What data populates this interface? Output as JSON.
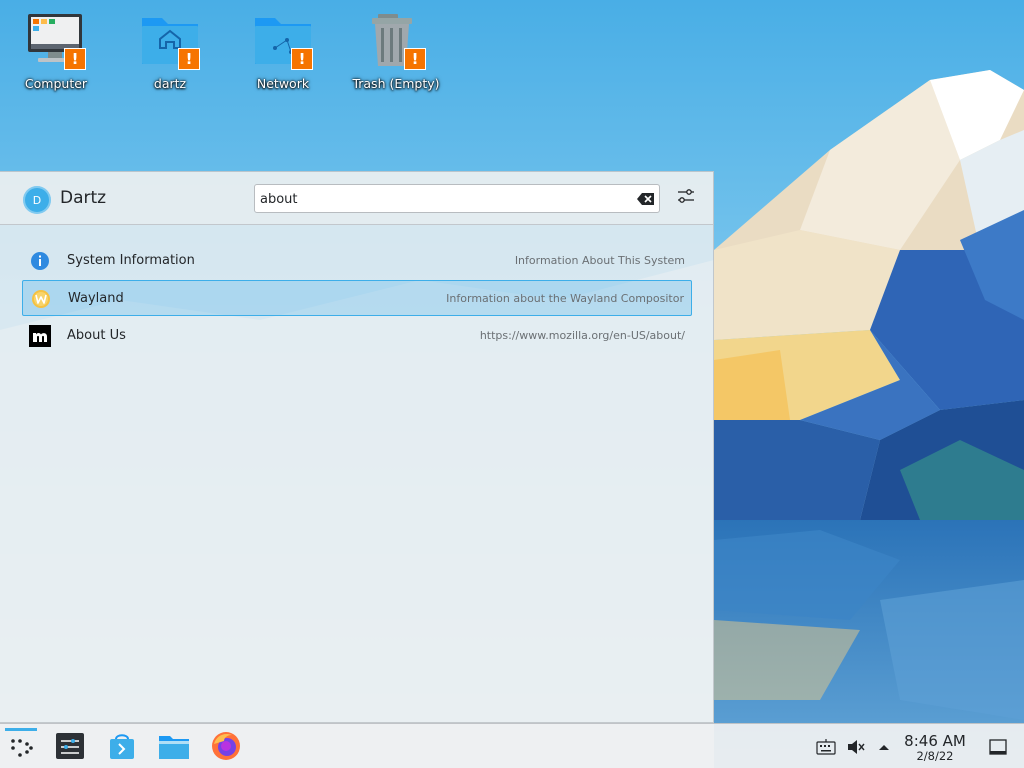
{
  "desktop": {
    "icons": [
      {
        "label": "Computer",
        "icon": "computer-icon"
      },
      {
        "label": "dartz",
        "icon": "home-folder-icon"
      },
      {
        "label": "Network",
        "icon": "network-folder-icon"
      },
      {
        "label": "Trash (Empty)",
        "icon": "trash-icon"
      }
    ],
    "warning_symbol": "!"
  },
  "launcher": {
    "user": {
      "initial": "D",
      "name": "Dartz"
    },
    "search": {
      "value": "about"
    },
    "results": [
      {
        "title": "System Information",
        "subtitle": "Information About This System",
        "icon": "info-icon",
        "selected": false
      },
      {
        "title": "Wayland",
        "subtitle": "Information about the Wayland Compositor",
        "icon": "wayland-icon",
        "selected": true
      },
      {
        "title": "About Us",
        "subtitle": "https://www.mozilla.org/en-US/about/",
        "icon": "mozilla-icon",
        "selected": false
      }
    ]
  },
  "taskbar": {
    "apps": [
      "application-launcher-icon",
      "system-settings-icon",
      "discover-icon",
      "dolphin-icon",
      "firefox-icon"
    ],
    "tray": [
      "keyboard-icon",
      "volume-muted-icon",
      "tray-expand-icon"
    ],
    "clock": {
      "time": "8:46 AM",
      "date": "2/8/22"
    }
  },
  "colors": {
    "accent": "#3daee9",
    "warning": "#f67400",
    "panel": "#eff0f1",
    "text": "#232629"
  }
}
